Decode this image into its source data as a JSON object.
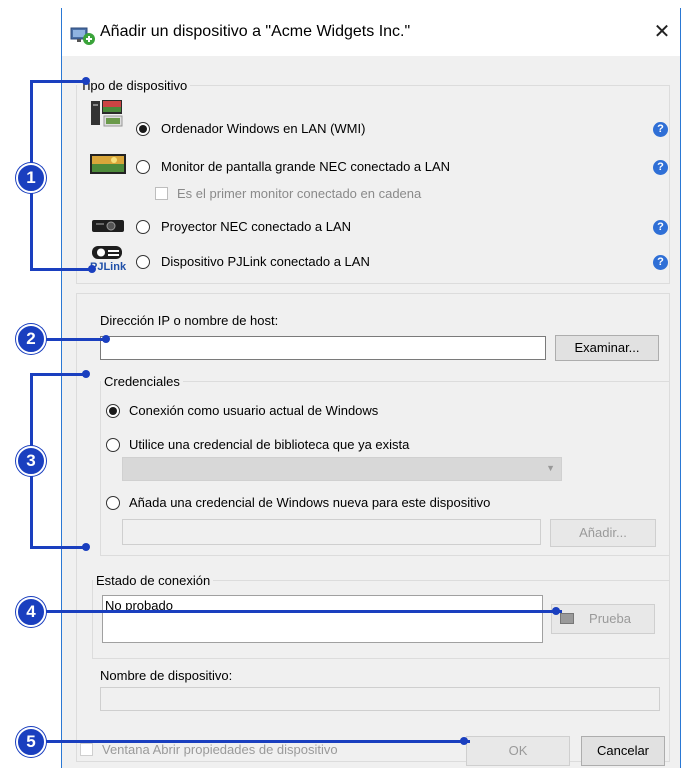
{
  "window": {
    "title": "Añadir un dispositivo a \"Acme Widgets Inc.\"",
    "close_glyph": "✕"
  },
  "device_type": {
    "legend": "Tipo de dispositivo",
    "options": [
      {
        "label": "Ordenador Windows en LAN (WMI)",
        "selected": true,
        "icon": "windows-computer-icon"
      },
      {
        "label": "Monitor de pantalla grande NEC conectado a LAN",
        "selected": false,
        "icon": "large-display-icon"
      },
      {
        "label": "Proyector NEC conectado a LAN",
        "selected": false,
        "icon": "projector-icon"
      },
      {
        "label": "Dispositivo PJLink conectado a LAN",
        "selected": false,
        "icon": "pjlink-icon"
      }
    ],
    "daisy_chain_label": "Es el primer monitor conectado en cadena",
    "pjlink_logo_text": "PJLink",
    "help_glyph": "?"
  },
  "host": {
    "label": "Dirección IP o nombre de host:",
    "value": "",
    "browse_label": "Examinar..."
  },
  "credentials": {
    "legend": "Credenciales",
    "options": [
      {
        "label": "Conexión como usuario actual de Windows",
        "selected": true
      },
      {
        "label": "Utilice una credencial de biblioteca que ya exista",
        "selected": false
      },
      {
        "label": "Añada una credencial de Windows nueva para este dispositivo",
        "selected": false
      }
    ],
    "library_select_value": "",
    "new_credential_value": "",
    "add_label": "Añadir..."
  },
  "connection": {
    "legend": "Estado de conexión",
    "status_text": "No probado",
    "test_label": "Prueba"
  },
  "device_name": {
    "label": "Nombre de dispositivo:",
    "value": ""
  },
  "footer": {
    "open_properties_label": "Ventana Abrir propiedades de dispositivo",
    "ok_label": "OK",
    "cancel_label": "Cancelar"
  },
  "callouts": [
    "1",
    "2",
    "3",
    "4",
    "5"
  ],
  "colors": {
    "callout": "#1a3fbf",
    "help": "#2f6fd6",
    "window_bg": "#f0f0f0",
    "title_border": "#2a78d4"
  }
}
